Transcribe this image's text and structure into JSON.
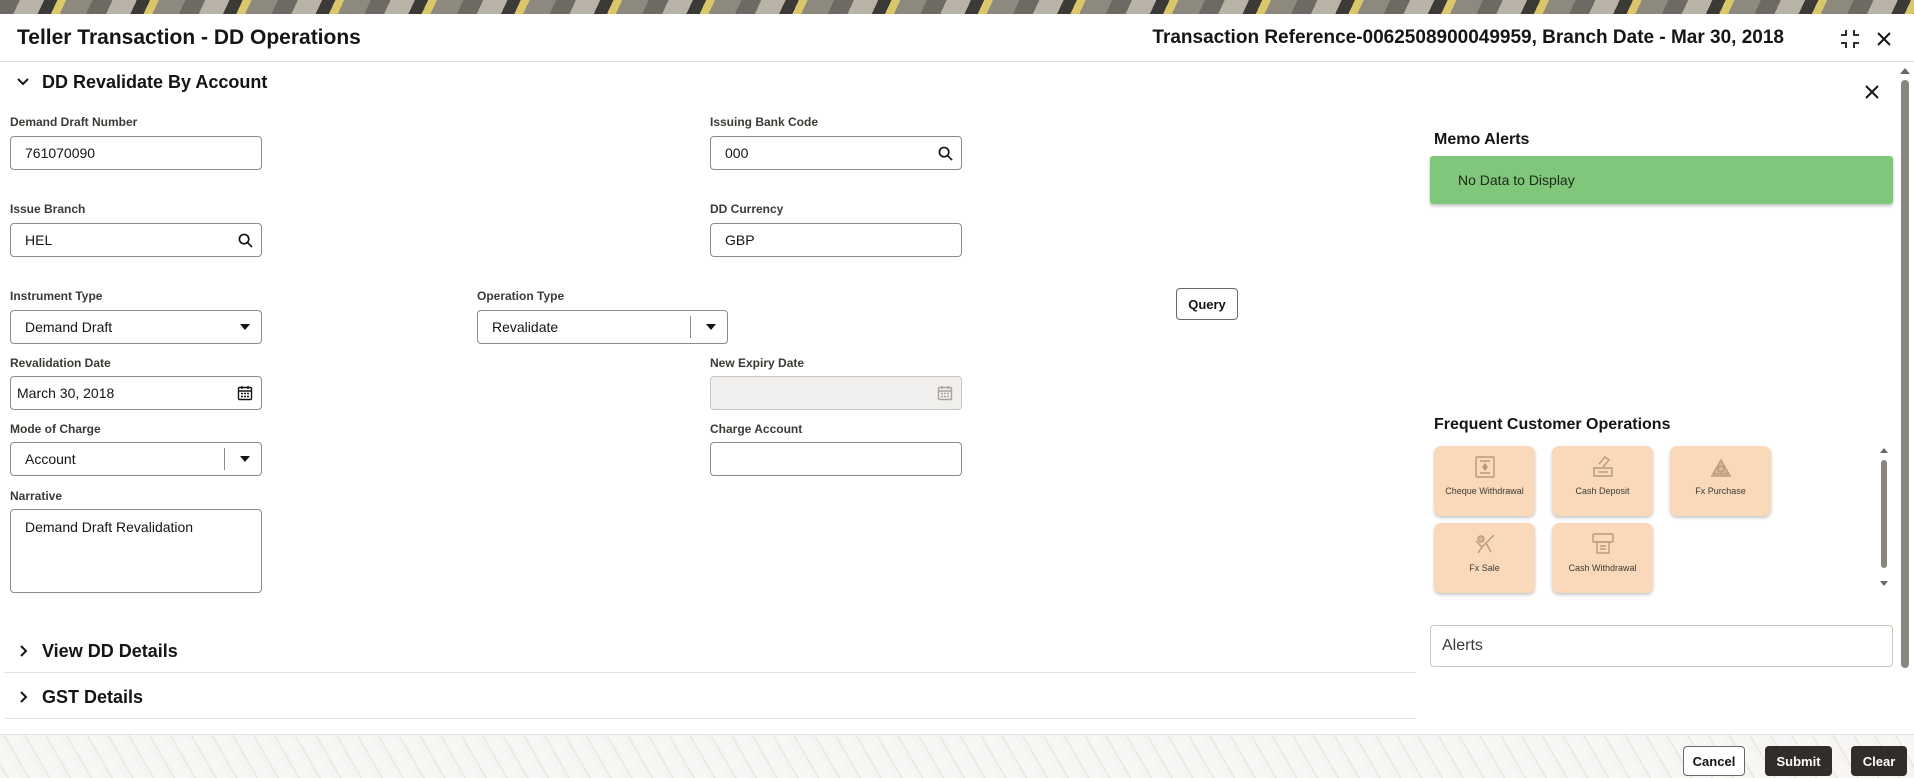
{
  "header": {
    "title": "Teller Transaction - DD Operations",
    "transaction_info": "Transaction Reference-0062508900049959, Branch Date - Mar 30, 2018"
  },
  "section_main": {
    "title": "DD Revalidate By Account",
    "fields": {
      "demand_draft_number": {
        "label": "Demand Draft Number",
        "value": "761070090"
      },
      "issuing_bank_code": {
        "label": "Issuing Bank Code",
        "value": "000"
      },
      "issue_branch": {
        "label": "Issue Branch",
        "value": "HEL"
      },
      "dd_currency": {
        "label": "DD Currency",
        "value": "GBP"
      },
      "instrument_type": {
        "label": "Instrument Type",
        "value": "Demand Draft"
      },
      "operation_type": {
        "label": "Operation Type",
        "value": "Revalidate"
      },
      "revalidation_date": {
        "label": "Revalidation Date",
        "value": "March 30, 2018"
      },
      "new_expiry_date": {
        "label": "New Expiry Date",
        "value": ""
      },
      "mode_of_charge": {
        "label": "Mode of Charge",
        "value": "Account"
      },
      "charge_account": {
        "label": "Charge Account",
        "value": ""
      },
      "narrative": {
        "label": "Narrative",
        "value": "Demand Draft Revalidation"
      }
    },
    "query_label": "Query"
  },
  "sections_collapsed": [
    {
      "title": "View DD Details"
    },
    {
      "title": "GST Details"
    }
  ],
  "side_panel": {
    "memo_alerts": {
      "title": "Memo Alerts",
      "message": "No Data to Display",
      "color": "#80c77b"
    },
    "frequent_ops": {
      "title": "Frequent Customer Operations",
      "tile_color": "#f9d9b9",
      "items": [
        {
          "label": "Cheque Withdrawal",
          "icon": "cheque-icon"
        },
        {
          "label": "Cash Deposit",
          "icon": "cash-deposit-icon"
        },
        {
          "label": "Fx Purchase",
          "icon": "fx-purchase-icon"
        },
        {
          "label": "Fx Sale",
          "icon": "fx-sale-icon"
        },
        {
          "label": "Cash Withdrawal",
          "icon": "cash-withdrawal-icon"
        }
      ]
    },
    "alerts_label": "Alerts"
  },
  "footer": {
    "cancel_label": "Cancel",
    "submit_label": "Submit",
    "clear_label": "Clear",
    "button_color": "#312d2a"
  }
}
